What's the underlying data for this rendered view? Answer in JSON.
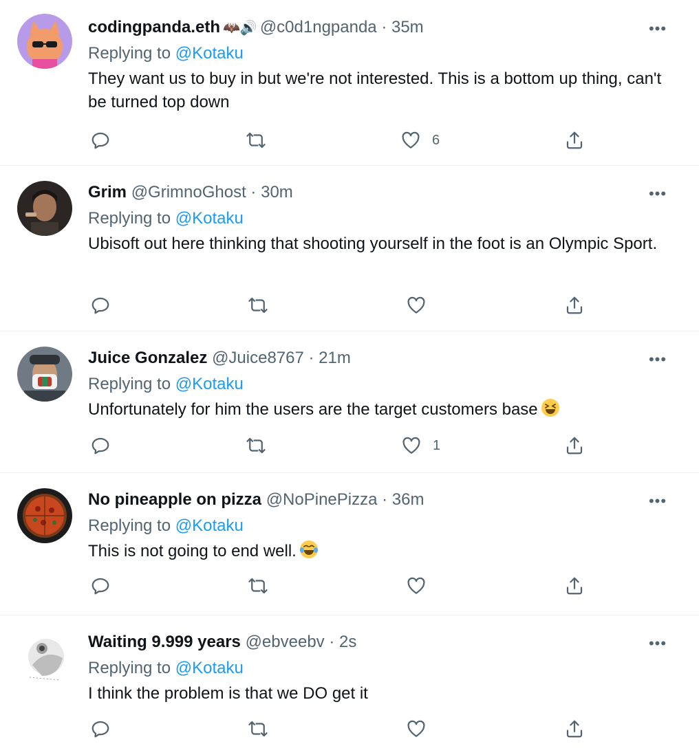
{
  "tweets": [
    {
      "name": "codingpanda.eth",
      "badge": "🦇🔊",
      "handle": "@c0d1ngpanda",
      "sep": " · ",
      "time": "35m",
      "replying_prefix": "Replying to ",
      "replying_to": "@Kotaku",
      "text": "They want us to buy in but we're not interested. This is a bottom up thing, can't be turned top down",
      "likes": "6"
    },
    {
      "name": "Grim",
      "handle": "@GrimnoGhost",
      "sep": " · ",
      "time": "30m",
      "replying_prefix": "Replying to ",
      "replying_to": "@Kotaku",
      "text": "Ubisoft out here thinking that shooting yourself in the foot is an Olympic Sport.",
      "likes": ""
    },
    {
      "name": "Juice Gonzalez",
      "handle": "@Juice8767",
      "sep": " · ",
      "time": "21m",
      "replying_prefix": "Replying to ",
      "replying_to": "@Kotaku",
      "text": "Unfortunately for him the users are the target customers base",
      "likes": "1"
    },
    {
      "name": "No pineapple on pizza",
      "handle": "@NoPinePizza",
      "sep": " · ",
      "time": "36m",
      "replying_prefix": "Replying to ",
      "replying_to": "@Kotaku",
      "text": "This is not going to end well.",
      "likes": ""
    },
    {
      "name": "Waiting 9.999 years",
      "handle": "@ebveebv",
      "sep": " · ",
      "time": "2s",
      "replying_prefix": "Replying to ",
      "replying_to": "@Kotaku",
      "text": "I think the problem is that we DO get it",
      "likes": ""
    }
  ],
  "icons": {
    "more": "more-horizontal-icon",
    "reply": "reply-bubble-icon",
    "retweet": "retweet-icon",
    "like": "heart-icon",
    "share": "share-upload-icon"
  },
  "colors": {
    "link": "#1d9bf0",
    "secondary_text": "#536471",
    "primary_text": "#0f1419",
    "divider": "#eff3f4"
  }
}
